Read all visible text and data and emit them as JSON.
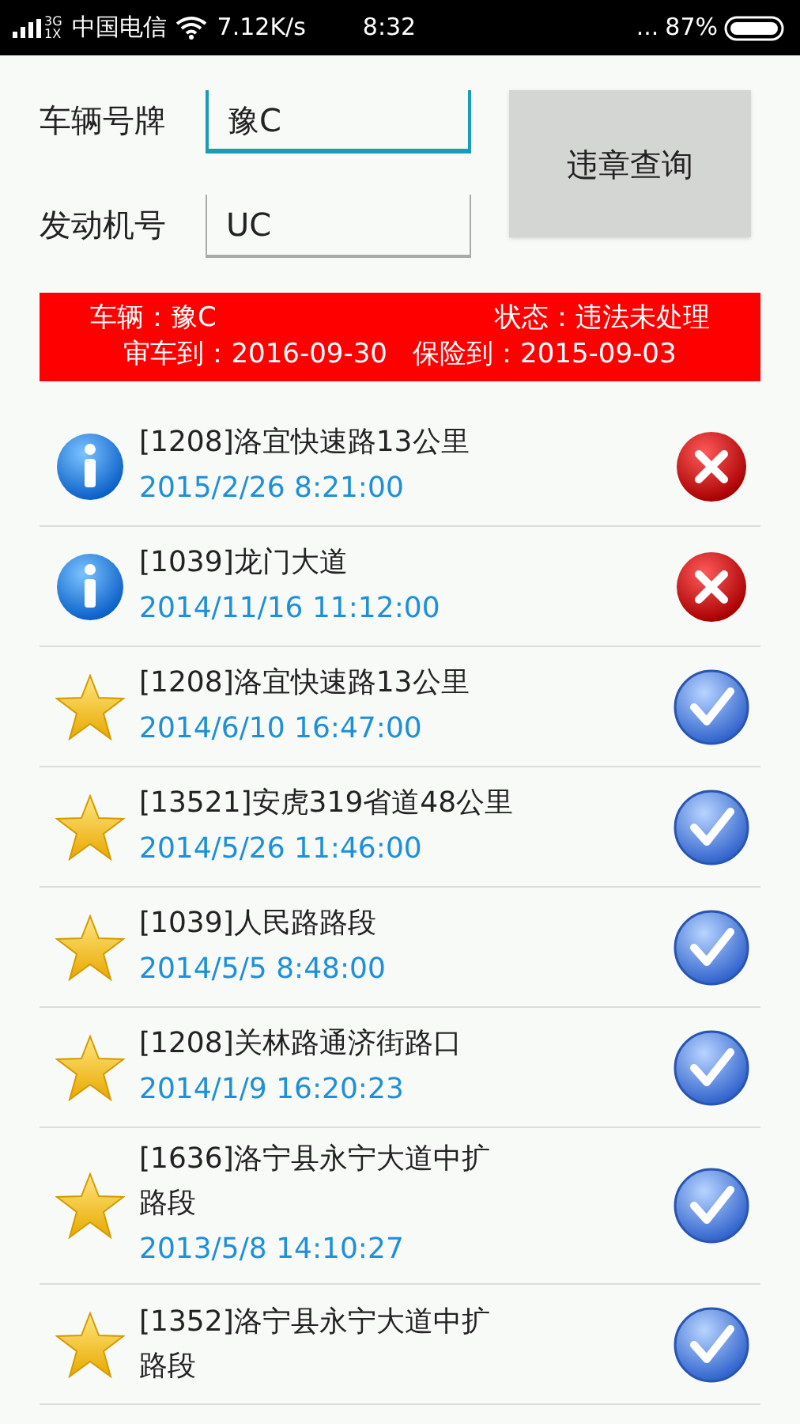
{
  "status_bar": {
    "network": "3G",
    "network_2": "1X",
    "carrier": "中国电信",
    "speed": "7.12K/s",
    "time": "8:32",
    "more": "...",
    "battery": "87%"
  },
  "form": {
    "fields": [
      {
        "label": "车辆号牌",
        "value": "豫C",
        "focused": true
      },
      {
        "label": "发动机号",
        "value": "UC",
        "focused": false
      }
    ],
    "button": "违章查询"
  },
  "banner": {
    "vehicle_label": "车辆：",
    "vehicle": "豫C",
    "status": "状态：违法未处理",
    "inspection": "审车到：2016-09-30",
    "insurance": "保险到：2015-09-03"
  },
  "records": [
    {
      "kind": "info",
      "title": "[1208]洛宜快速路13公里",
      "time": "2015/2/26 8:21:00",
      "handled": false
    },
    {
      "kind": "info",
      "title": "[1039]龙门大道",
      "time": "2014/11/16 11:12:00",
      "handled": false
    },
    {
      "kind": "star",
      "title": "[1208]洛宜快速路13公里",
      "time": "2014/6/10 16:47:00",
      "handled": true
    },
    {
      "kind": "star",
      "title": "[13521]安虎319省道48公里",
      "time": "2014/5/26 11:46:00",
      "handled": true
    },
    {
      "kind": "star",
      "title": "[1039]人民路路段",
      "time": "2014/5/5 8:48:00",
      "handled": true
    },
    {
      "kind": "star",
      "title": "[1208]关林路通济街路口",
      "time": "2014/1/9 16:20:23",
      "handled": true
    },
    {
      "kind": "star",
      "title": "[1636]洛宁县永宁大道中扩",
      "title_2": "路段",
      "time": "2013/5/8 14:10:27",
      "handled": true
    },
    {
      "kind": "star",
      "title": "[1352]洛宁县永宁大道中扩",
      "title_2": "路段",
      "handled": true
    }
  ]
}
